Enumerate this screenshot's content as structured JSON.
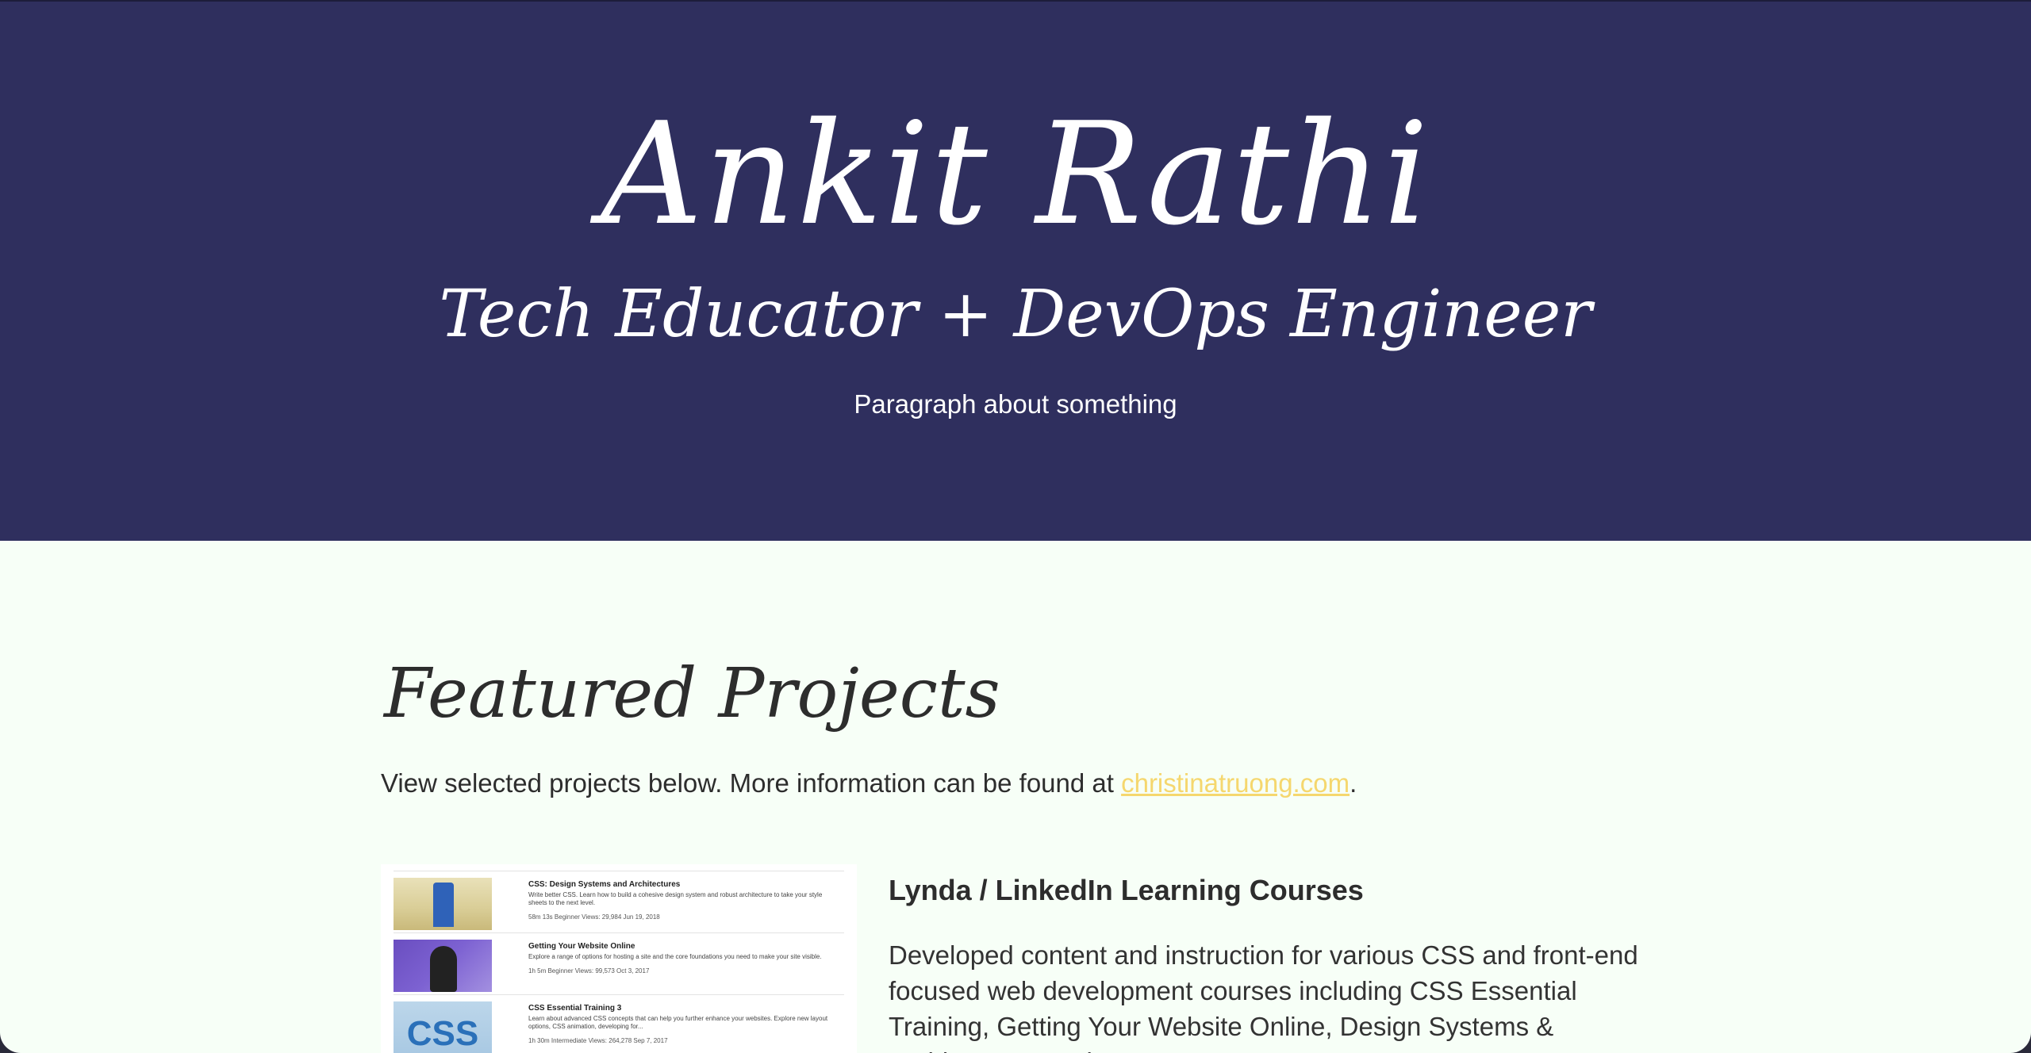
{
  "hero": {
    "name": "Ankit Rathi",
    "subtitle": "Tech Educator + DevOps Engineer",
    "paragraph": "Paragraph about something"
  },
  "featured": {
    "title": "Featured Projects",
    "intro_text": "View selected projects below. More information can be found at ",
    "intro_link": "christinatruong.com",
    "intro_end": "."
  },
  "project": {
    "title": "Lynda / LinkedIn Learning Courses",
    "description": "Developed content and instruction for various CSS and front-end focused web development courses including CSS Essential Training, Getting Your Website Online, Design Systems & Architectures and more.",
    "courses": [
      {
        "title": "CSS: Design Systems and Architectures",
        "description": "Write better CSS. Learn how to build a cohesive design system and robust architecture to take your style sheets to the next level.",
        "meta": "58m 13s   Beginner   Views: 29,984   Jun 19, 2018"
      },
      {
        "title": "Getting Your Website Online",
        "description": "Explore a range of options for hosting a site and the core foundations you need to make your site visible.",
        "meta": "1h 5m   Beginner   Views: 99,573   Oct 3, 2017"
      },
      {
        "title": "CSS Essential Training 3",
        "description": "Learn about advanced CSS concepts that can help you further enhance your websites. Explore new layout options, CSS animation, developing for...",
        "meta": "1h 30m   Intermediate   Views: 264,278   Sep 7, 2017"
      }
    ],
    "thumb_glyph": "CSS"
  },
  "colors": {
    "hero_bg": "#2f2f5e",
    "page_bg": "#f7fff7",
    "link": "#f5d76e",
    "text": "#2d2d2d"
  }
}
